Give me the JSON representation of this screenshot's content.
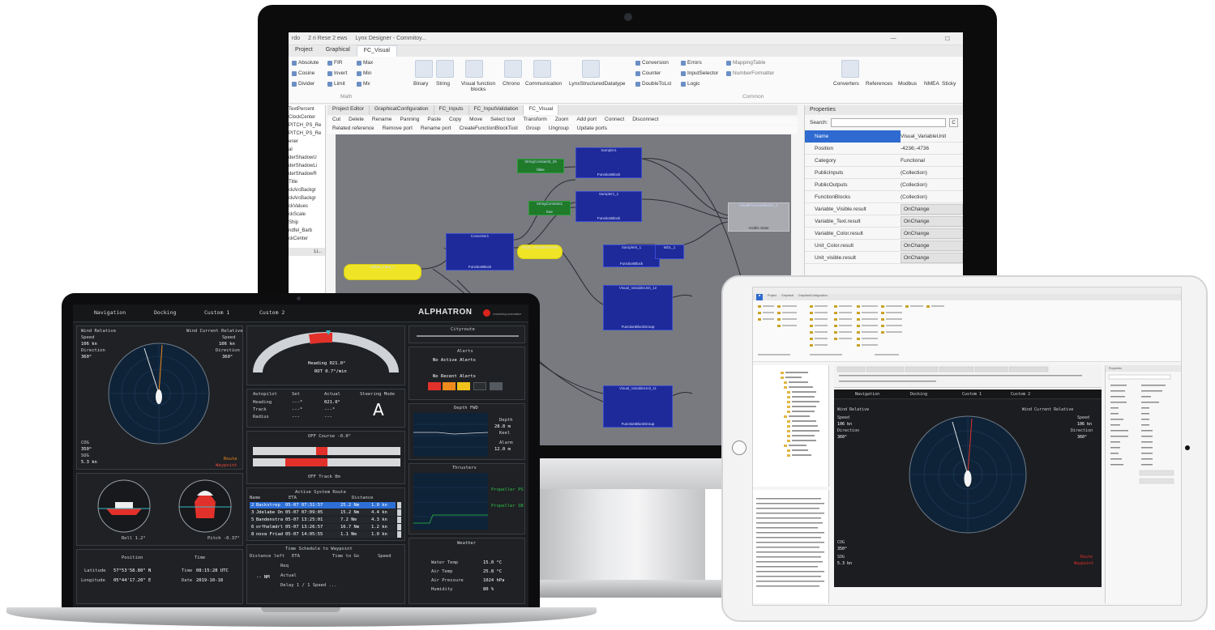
{
  "monitor": {
    "title_bar": {
      "left": "rdo",
      "mid": "2 ri Rese 2 ews",
      "app": "Lynx Designer - Commitoy..."
    },
    "ribbon_tabs": [
      "Project",
      "Graphical",
      "FC_Visual"
    ],
    "ribbon_items": {
      "col1": [
        "Absolute",
        "Cosine",
        "Divider"
      ],
      "col2": [
        "FIR",
        "Invert",
        "Limit"
      ],
      "col3": [
        "Max",
        "Min",
        "Mx"
      ],
      "group_math": "Math",
      "bigs": [
        "Binary",
        "String",
        "Visual function blocks",
        "Chrono",
        "Communication",
        "LynxStructuredDatatype"
      ],
      "conv_col1": [
        "Conversion",
        "Counter",
        "DoubleToLst"
      ],
      "conv_col2": [
        "Errors",
        "InputSelector",
        "Logic"
      ],
      "conv_col3": [
        "MappingTable",
        "NumberFormatter"
      ],
      "group_common": "Common",
      "right_bigs": [
        "Converters",
        "References",
        "Modbus",
        "NMEA",
        "Sticky"
      ]
    },
    "left_panel": {
      "items": [
        "TextPercent",
        "ClockCenter",
        "PITCH_PS_Re",
        "PITCH_PS_Re",
        "ener",
        "al",
        "derShadowU",
        "derShadowLi",
        "derShadowR",
        "Title",
        "ckArcBackgr",
        "ckArcBackgr",
        "ckValues",
        "ckScale",
        "Ship",
        "ndfel_Barb",
        "ckCenter"
      ],
      "bottom_tab": "Li..."
    },
    "doc_tabs": [
      "Project Editor",
      "GraphicalConfiguration",
      "FC_Inputs",
      "FC_InputValidation",
      "FC_Visual"
    ],
    "toolbar_row1": [
      "Cut",
      "Delete",
      "Rename",
      "Panning",
      "Paste",
      "Copy",
      "Move",
      "Select tool",
      "Transform",
      "Zoom",
      "Add port",
      "Connect",
      "Disconnect"
    ],
    "toolbar_row2": [
      "Related reference",
      "Remove port",
      "Rename port",
      "CreateFunctionBlockTool",
      "Group",
      "Ungroup",
      "Update ports"
    ],
    "canvas": {
      "blocks": [
        {
          "name": "StringConstant3_05",
          "kind": "green",
          "body": "false"
        },
        {
          "name": "StringConstant1",
          "kind": "green",
          "body": "true"
        },
        {
          "name": "Sampler1",
          "kind": "blue",
          "body": "FunctionBlock"
        },
        {
          "name": "Sampler1_1",
          "kind": "blue",
          "body": "FunctionBlock"
        },
        {
          "name": "Converter1",
          "kind": "blue",
          "body": "FunctionBlock"
        },
        {
          "name": "Sampler5_1",
          "kind": "blue",
          "body": "FunctionBlock"
        },
        {
          "name": "MDL_1",
          "kind": "blue",
          "body": ""
        },
        {
          "name": "Visual_VariableUnit_12",
          "kind": "blue",
          "body": "FunctionBlockGroup"
        },
        {
          "name": "Visual_VariableUnit_11",
          "kind": "blue",
          "body": "FunctionBlockGroup"
        },
        {
          "name": "Yellow_input_1",
          "kind": "yellow",
          "body": ""
        },
        {
          "name": "Tinput_VisualElements",
          "kind": "yellow",
          "body": ""
        },
        {
          "name": "VisualFunctionBlock1_1",
          "kind": "grey",
          "body": "Visible State"
        }
      ]
    },
    "properties": {
      "title": "Properties",
      "search_label": "Search:",
      "rows": [
        {
          "k": "Name",
          "v": "Visual_VariableUnit",
          "sel": true
        },
        {
          "k": "Position",
          "v": "-4236;-4736"
        },
        {
          "k": "Category",
          "v": "Functional"
        },
        {
          "k": "PublicInputs",
          "v": "(Collection)"
        },
        {
          "k": "PublicOutputs",
          "v": "(Collection)"
        },
        {
          "k": "FunctionBlocks",
          "v": "(Collection)"
        },
        {
          "k": "Variable_Visible.result",
          "v": "OnChange",
          "btn": true
        },
        {
          "k": "Variable_Text.result",
          "v": "OnChange",
          "btn": true
        },
        {
          "k": "Variable_Color.result",
          "v": "OnChange",
          "btn": true
        },
        {
          "k": "Unit_Color.result",
          "v": "OnChange",
          "btn": true
        },
        {
          "k": "Unit_visible.result",
          "v": "OnChange",
          "btn": true
        }
      ]
    }
  },
  "laptop": {
    "tabs": [
      "Navigation",
      "Docking",
      "Custom 1",
      "Custom 2"
    ],
    "brand": "ALPHATRON",
    "brand_sub": "connecting automation",
    "wind": {
      "label_left": "Wind Relative",
      "label_right": "Wind Current Relative",
      "speed_l": "Speed",
      "speed_val_l": "106 kn",
      "dir_l": "Direction",
      "dir_val_l": "360°",
      "speed_r": "Speed",
      "speed_val_r": "106 kn",
      "dir_r": "Direction",
      "dir_val_r": "360°"
    },
    "compass_bottom": {
      "cog_l": "COG",
      "cog_v": "350°",
      "sog_l": "SOG",
      "sog_v": "5.3 kn",
      "legend1": "Route",
      "legend2": "Waypoint"
    },
    "heading_gauge": {
      "heading": "Heading 021.0°",
      "rot": "ROT 0.7°/min"
    },
    "autopilot": {
      "cols": [
        "Autopilot",
        "Set",
        "Actual",
        "Steering Mode"
      ],
      "rows": [
        [
          "Heading",
          "---°",
          "021.0°"
        ],
        [
          "Track",
          "---°",
          "---°"
        ],
        [
          "Radius",
          "---",
          "---"
        ]
      ],
      "mode": "A"
    },
    "off_course": "OFF Course -0.0°",
    "off_track": "OFF Track 0m",
    "roll": "Roll 1.2°",
    "pitch": "Pitch -0.37°",
    "position": {
      "title": "Position",
      "lat_l": "Latitude",
      "lat_v": "57°53'58.80\" N",
      "lon_l": "Longitude",
      "lon_v": "05°44'17.20\" E",
      "time_t": "Time",
      "time_l": "Time",
      "time_v": "08:15:28 UTC",
      "date_l": "Date",
      "date_v": "2019-10-18"
    },
    "active_route": {
      "title": "Active System Route",
      "head": [
        "Name",
        "ETA",
        "Distance"
      ],
      "rows": [
        [
          "2",
          "Backstrep",
          "05-07 07:31:57",
          "25.2 Nm",
          "1.0 kn"
        ],
        [
          "3",
          "Jdelabe On",
          "05-07 07:09:05",
          "15.2 Nm",
          "4.4 kn"
        ],
        [
          "5",
          "Bandenstra",
          "05-07 13:25:01",
          "7.2 Nm",
          "4.3 kn"
        ],
        [
          "6",
          "orfhelmdrl",
          "05-07 13:26:57",
          "16.7 Nm",
          "1.2 kn"
        ],
        [
          "8",
          "nova Friad",
          "05-07 14:05:55",
          "1.1 Nm",
          "1.0 kn"
        ]
      ]
    },
    "time_schedule": {
      "title": "Time Schedule to Waypoint",
      "heads": [
        "Distance left",
        "ETA",
        "Time to Go",
        "Speed"
      ],
      "val": "-- NM",
      "rows": [
        "Req",
        "Actual",
        "Delay 1 / 1 Speed ..."
      ]
    },
    "right": {
      "thruster_title": "Cityroute",
      "alerts_title": "Alerts",
      "alerts_active": "No Active Alerts",
      "alerts_recent": "No Recent Alerts",
      "depth_title": "Depth FWD",
      "depth_l": "Depth",
      "depth_v": "28.8 m",
      "depth_l2": "Keel",
      "depth_l3": "Alarm",
      "depth_v3": "12.0 m",
      "thrusters_title": "Thrusters",
      "thr_l1": "Propeller PS",
      "thr_l2": "Propeller SB",
      "weather_title": "Weather",
      "w_rows": [
        [
          "Water Temp",
          "15.0 °C"
        ],
        [
          "Air Temp",
          "25.8 °C"
        ],
        [
          "Air Pressure",
          "1024 hPa"
        ],
        [
          "Humidity",
          "80 %"
        ]
      ]
    }
  },
  "tablet": {
    "tabs": [
      "Navigation",
      "Docking",
      "Custom 1",
      "Custom 2"
    ],
    "wind_left": "Wind Relative",
    "wind_right": "Wind Current Relative",
    "speed": "Speed",
    "speed_v": "106 kn",
    "dir": "Direction",
    "dir_v": "360°",
    "cog": "COG",
    "cog_v": "350°",
    "sog": "SOG",
    "sog_v": "5.3 kn",
    "legend1": "Route",
    "legend2": "Waypoint",
    "ribbon_tabs": [
      "Project",
      "Graphical",
      "GraphicalConfiguration"
    ],
    "props_title": "Properties"
  }
}
